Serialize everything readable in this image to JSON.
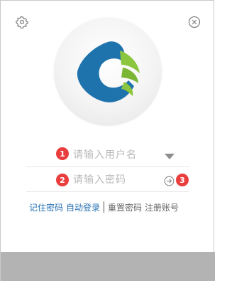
{
  "window": {
    "footer_color": "#b3b3b3",
    "accent_blue": "#2a73b4",
    "badge_red": "#ea3d3d"
  },
  "header": {
    "settings_icon": "gear-icon",
    "close_icon": "close-circle-icon"
  },
  "avatar": {
    "logo_colors": [
      "#1f73ad",
      "#8cc63e"
    ]
  },
  "form": {
    "username_placeholder": "请输入用户名",
    "password_placeholder": "请输入密码",
    "dropdown_icon": "caret-down-icon",
    "submit_icon": "arrow-right-circle-icon"
  },
  "badges": [
    "1",
    "2",
    "3"
  ],
  "links": {
    "remember": "记住密码",
    "auto_login": "自动登录",
    "reset": "重置密码",
    "register": "注册账号"
  }
}
